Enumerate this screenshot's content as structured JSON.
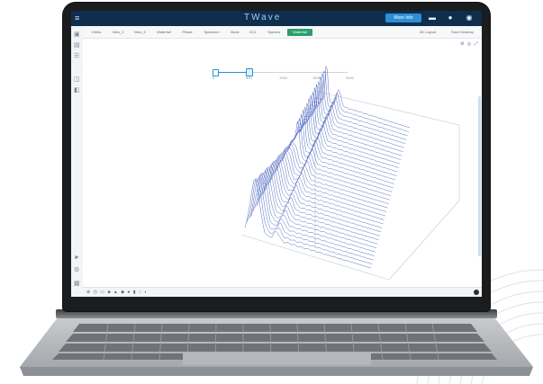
{
  "app": {
    "brand_left": "",
    "logo": "TWave",
    "top_button": "More Info",
    "icons": {
      "menu": "hamburger-icon",
      "chat": "chat-icon",
      "help": "help-icon",
      "user": "user-icon"
    },
    "colors": {
      "topbar": "#0f2d4c",
      "accent": "#2c8fd6",
      "active_tab": "#2aa06c",
      "plot_lines": "#3b57b8"
    }
  },
  "tabs": [
    {
      "label": "Orbits",
      "active": false
    },
    {
      "label": "View_2",
      "active": false
    },
    {
      "label": "View_3",
      "active": false
    },
    {
      "label": "Waterfall",
      "active": false
    },
    {
      "label": "Phase",
      "active": false
    },
    {
      "label": "Spectrum",
      "active": false
    },
    {
      "label": "Bode",
      "active": false
    },
    {
      "label": "DCL",
      "active": false
    },
    {
      "label": "Spectra",
      "active": false
    },
    {
      "label": "Waterfall",
      "active": true
    }
  ],
  "tab_actions": {
    "layout": "3D Layout",
    "save": "Save Desktop"
  },
  "breadcrumb": "",
  "slider": {
    "ticks": [
      "0",
      "500",
      "1000",
      "1500",
      "2000"
    ]
  },
  "plot": {
    "axis_title": ""
  }
}
